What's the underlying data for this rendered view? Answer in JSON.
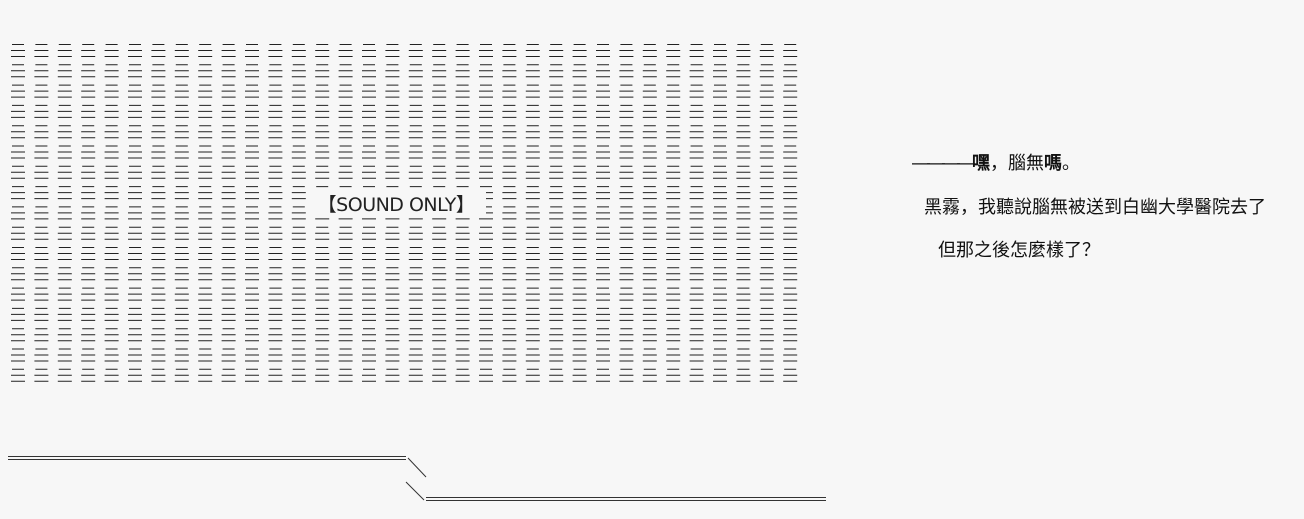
{
  "sound_only": {
    "label": "【SOUND ONLY】",
    "pattern_glyph": "ニ",
    "pattern_rows": 17,
    "pattern_cols": 34
  },
  "dialogue": {
    "line1_dash": "――――",
    "line1_bold_a": "嘿",
    "line1_plain": "，腦無",
    "line1_bold_b": "嗎",
    "line1_end": "。",
    "line2": "黑霧，我聽說腦無被送到白幽大學醫院去了",
    "line3": "但那之後怎麼樣了？"
  }
}
